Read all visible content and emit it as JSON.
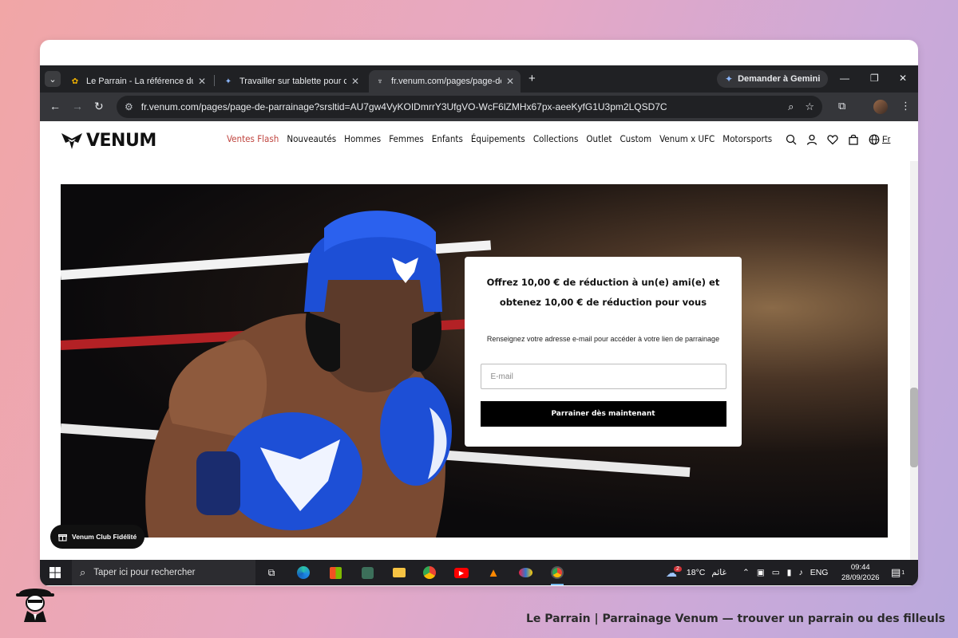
{
  "browser": {
    "tabs": [
      {
        "title": "Le Parrain - La référence du parrainage",
        "active": false
      },
      {
        "title": "Travailler sur tablette pour clients",
        "active": false
      },
      {
        "title": "fr.venum.com/pages/page-de-parrainage",
        "active": true
      }
    ],
    "gemini_label": "Demander à Gemini",
    "url": "fr.venum.com/pages/page-de-parrainage?srsltid=AU7gw4VyKOIDmrrY3UfgVO-WcF6lZMHx67px-aeeKyfG1U3pm2LQSD7C"
  },
  "site": {
    "brand": "VENUM",
    "nav": [
      "Ventes Flash",
      "Nouveautés",
      "Hommes",
      "Femmes",
      "Enfants",
      "Équipements",
      "Collections",
      "Outlet",
      "Custom",
      "Venum x UFC",
      "Motorsports"
    ],
    "lang": "Fr",
    "accent_color": "#c0453f"
  },
  "referral": {
    "title": "Offrez 10,00 € de réduction à un(e) ami(e) et obtenez 10,00 € de réduction pour vous",
    "subtitle": "Renseignez votre adresse e-mail pour accéder à votre lien de parrainage",
    "email_placeholder": "E-mail",
    "cta": "Parrainer dès maintenant"
  },
  "loyalty_button": "Venum Club Fidélité",
  "taskbar": {
    "search_placeholder": "Taper ici pour rechercher",
    "weather_temp": "18°C",
    "weather_text": "غائم",
    "weather_badge": "2",
    "language": "ENG",
    "time": "09:44",
    "date": "28/09/2026",
    "notifications": "1"
  },
  "caption": "Le Parrain | Parrainage Venum — trouver un parrain ou des filleuls"
}
